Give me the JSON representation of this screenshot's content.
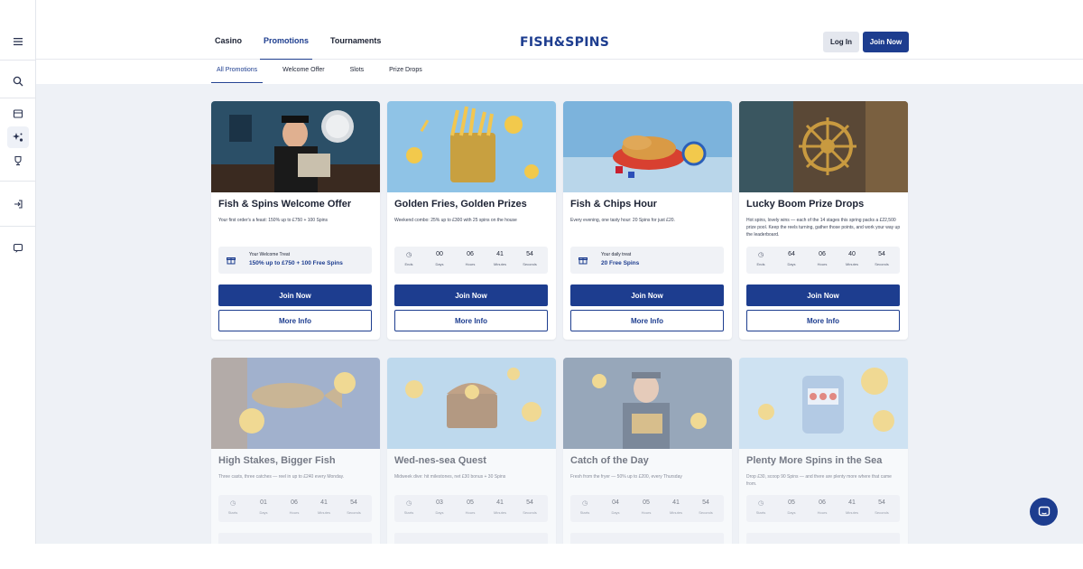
{
  "rail": {
    "icons": [
      "menu-icon",
      "search-icon",
      "casino-icon",
      "promotions-icon",
      "trophy-icon",
      "signin-icon",
      "chat-icon"
    ]
  },
  "header": {
    "nav": [
      "Casino",
      "Promotions",
      "Tournaments"
    ],
    "active_nav": "Promotions",
    "logo": "FISH&SPINS",
    "login_label": "Log In",
    "join_label": "Join Now"
  },
  "subtabs": [
    "All Promotions",
    "Welcome Offer",
    "Slots",
    "Prize Drops"
  ],
  "cards": [
    {
      "title": "Fish & Spins Welcome Offer",
      "desc": "Your first order's a feast: 150% up to £750 + 100 Spins",
      "offer_line1": "Your Welcome Treat",
      "offer_line2": "150% up to £750 + 100 Free Spins",
      "join": "Join Now",
      "more": "More Info"
    },
    {
      "title": "Golden Fries, Golden Prizes",
      "desc": "Weekend combo: 25% up to £300 with 25 spins on the house",
      "countdown": {
        "label": "Ends",
        "days": "00",
        "hours": "06",
        "minutes": "41",
        "seconds": "54",
        "u_days": "Days",
        "u_hours": "Hours",
        "u_minutes": "Minutes",
        "u_seconds": "Seconds"
      },
      "join": "Join Now",
      "more": "More Info"
    },
    {
      "title": "Fish & Chips Hour",
      "desc": "Every evening, one tasty hour: 20 Spins for just £20.",
      "offer_line1": "Your daily treat",
      "offer_line2": "20 Free Spins",
      "join": "Join Now",
      "more": "More Info"
    },
    {
      "title": "Lucky Boom Prize Drops",
      "desc": "Hot spins, lovely wins — each of the 14 stages this spring packs a £22,500 prize pool. Keep the reels turning, gather those points, and work your way up the leaderboard.",
      "countdown": {
        "label": "Ends",
        "days": "64",
        "hours": "06",
        "minutes": "40",
        "seconds": "54",
        "u_days": "Days",
        "u_hours": "Hours",
        "u_minutes": "Minutes",
        "u_seconds": "Seconds"
      },
      "join": "Join Now",
      "more": "More Info"
    },
    {
      "title": "High Stakes, Bigger Fish",
      "desc": "Three casts, three catches — reel in up to £240 every Monday.",
      "countdown": {
        "label": "Starts",
        "days": "01",
        "hours": "06",
        "minutes": "41",
        "seconds": "54",
        "u_days": "Days",
        "u_hours": "Hours",
        "u_minutes": "Minutes",
        "u_seconds": "Seconds"
      }
    },
    {
      "title": "Wed-nes-sea Quest",
      "desc": "Midweek dive: hit milestones, net £30 bonus + 30 Spins",
      "countdown": {
        "label": "Starts",
        "days": "03",
        "hours": "05",
        "minutes": "41",
        "seconds": "54",
        "u_days": "Days",
        "u_hours": "Hours",
        "u_minutes": "Minutes",
        "u_seconds": "Seconds"
      }
    },
    {
      "title": "Catch of the Day",
      "desc": "Fresh from the fryer — 50% up to £200, every Thursday",
      "countdown": {
        "label": "Starts",
        "days": "04",
        "hours": "05",
        "minutes": "41",
        "seconds": "54",
        "u_days": "Days",
        "u_hours": "Hours",
        "u_minutes": "Minutes",
        "u_seconds": "Seconds"
      }
    },
    {
      "title": "Plenty More Spins in the Sea",
      "desc": "Drop £30, scoop 90 Spins — and there are plenty more where that came from.",
      "countdown": {
        "label": "Starts",
        "days": "05",
        "hours": "06",
        "minutes": "41",
        "seconds": "54",
        "u_days": "Days",
        "u_hours": "Hours",
        "u_minutes": "Minutes",
        "u_seconds": "Seconds"
      }
    }
  ],
  "colors": {
    "brand": "#1d3d8f",
    "page_bg": "#eef1f6"
  }
}
